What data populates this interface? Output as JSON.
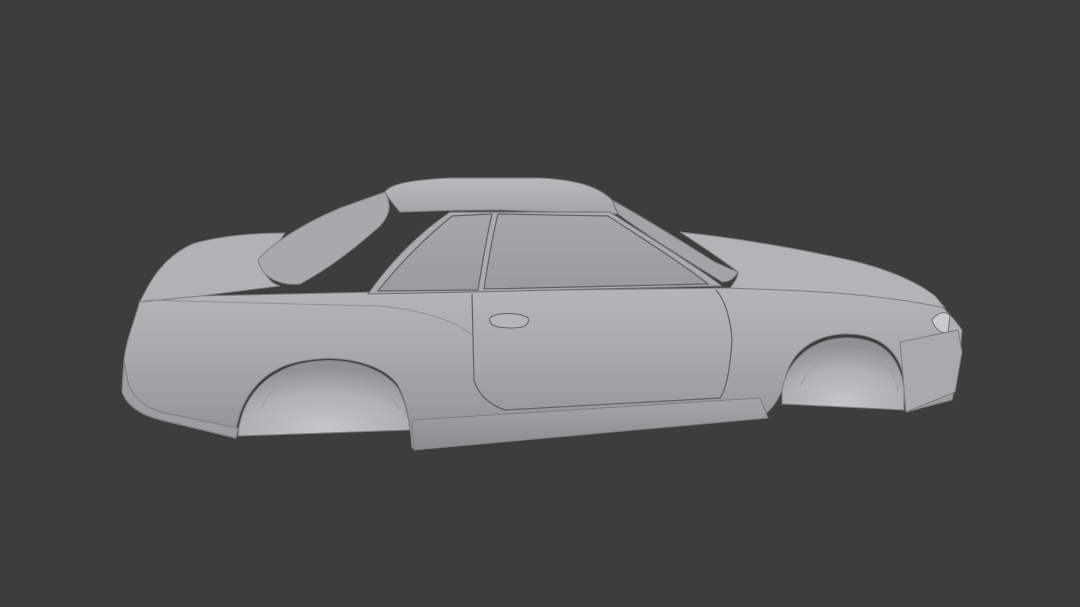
{
  "viewport": {
    "background_color": "#3d3d3d",
    "object": "car-body-model",
    "object_color": "#a7a9ab"
  }
}
